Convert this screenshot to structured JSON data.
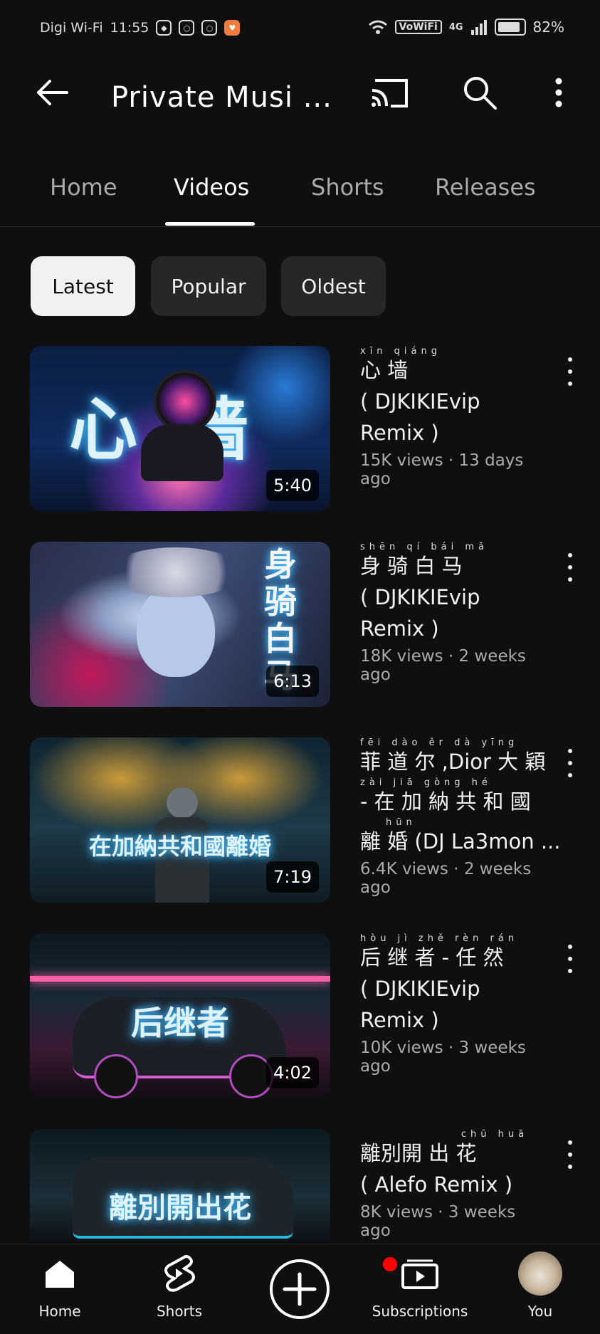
{
  "status_bar": {
    "carrier": "Digi Wi-Fi",
    "time": "11:55",
    "vowifi": "VoWiFi",
    "network": "4G",
    "battery": "82%"
  },
  "header": {
    "title": "Private Musi ...",
    "icons": [
      "back-arrow-icon",
      "cast-icon",
      "search-icon",
      "more-vert-icon"
    ]
  },
  "tabs": [
    {
      "label": "Home",
      "active": false
    },
    {
      "label": "Videos",
      "active": true
    },
    {
      "label": "Shorts",
      "active": false
    },
    {
      "label": "Releases",
      "active": false
    }
  ],
  "chips": [
    {
      "label": "Latest",
      "active": true
    },
    {
      "label": "Popular",
      "active": false
    },
    {
      "label": "Oldest",
      "active": false
    }
  ],
  "videos": [
    {
      "thumb_text": "心墙",
      "duration": "5:40",
      "pinyin": "xīn qiáng",
      "title_line1": "心 墙",
      "title_rest": "( DJKIKIEvip Remix )",
      "meta": "15K views · 13 days ago"
    },
    {
      "thumb_text": "身骑白马",
      "duration": "6:13",
      "pinyin": "shēn qí bái mǎ",
      "title_line1": "身 骑 白 马",
      "title_rest": "( DJKIKIEvip Remix )",
      "meta": "18K views · 2 weeks ago"
    },
    {
      "thumb_text": "在加納共和國離婚",
      "duration": "7:19",
      "pinyin": "fēi dào ěr        dà yīng",
      "title_line1": "菲 道 尔 ,Dior 大 穎",
      "pinyin2": "zài jiā  gòng hé",
      "title_line2": "- 在 加 納 共 和 國",
      "pinyin3": "hūn",
      "title_rest": "離 婚 (DJ La3mon ...",
      "meta": "6.4K views · 2 weeks ago"
    },
    {
      "thumb_text": "后继者",
      "duration": "4:02",
      "pinyin": "hòu jì zhě   rèn rán",
      "title_line1": "后 继 者 - 任 然",
      "title_rest": "( DJKIKIEvip Remix )",
      "meta": "10K views · 3 weeks ago"
    },
    {
      "thumb_text": "離別開出花",
      "duration": "",
      "pinyin": "              chū huā",
      "title_line1": "離別開 出 花",
      "title_rest": "( Alefo Remix )",
      "meta": "8K views · 3 weeks ago"
    }
  ],
  "bottom_nav": [
    {
      "label": "Home",
      "icon": "home-icon"
    },
    {
      "label": "Shorts",
      "icon": "shorts-icon"
    },
    {
      "label": "",
      "icon": "create-plus-icon"
    },
    {
      "label": "Subscriptions",
      "icon": "subscriptions-icon"
    },
    {
      "label": "You",
      "icon": "avatar"
    }
  ],
  "colors": {
    "background": "#0f0f0f",
    "chip_bg": "#272727",
    "notification": "#ff0000"
  }
}
